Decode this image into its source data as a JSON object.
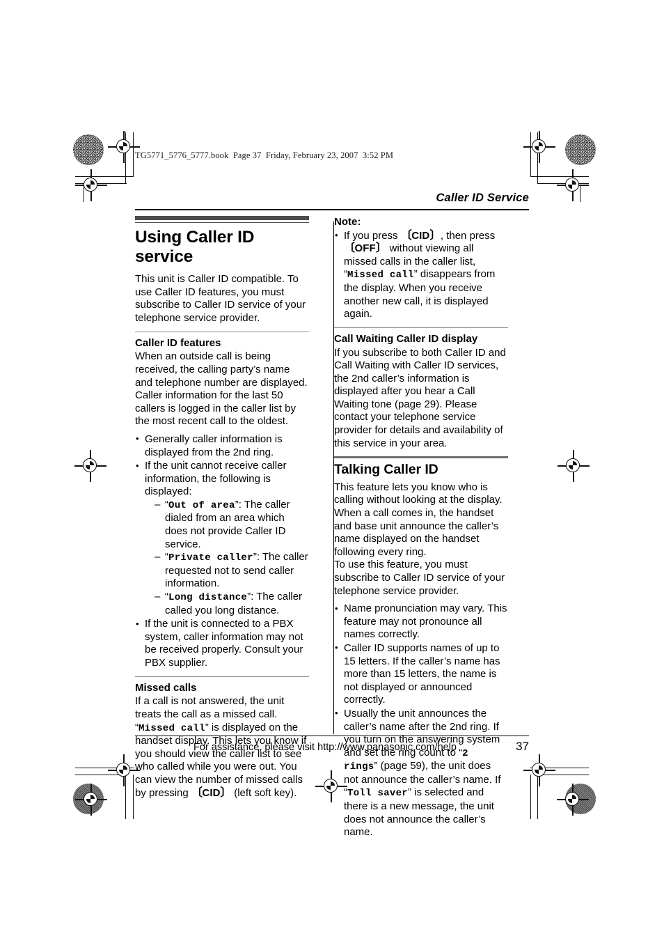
{
  "document": {
    "book_header": "TG5771_5776_5777.book  Page 37  Friday, February 23, 2007  3:52 PM",
    "running_head": "Caller ID Service",
    "footer_note": "For assistance, please visit http://www.panasonic.com/help",
    "page_number": "37"
  },
  "left_column": {
    "title": "Using Caller ID service",
    "intro": "This unit is Caller ID compatible. To use Caller ID features, you must subscribe to Caller ID service of your telephone service provider.",
    "features": {
      "heading": "Caller ID features",
      "para1": "When an outside call is being received, the calling party’s name and telephone number are displayed.",
      "para2": "Caller information for the last 50 callers is logged in the caller list by the most recent call to the oldest.",
      "bullet1": "Generally caller information is displayed from the 2nd ring.",
      "bullet2_lead": "If the unit cannot receive caller information, the following is displayed:",
      "sub_items": [
        {
          "quote_open": "“",
          "term": "Out of area",
          "quote_close": "”",
          "text": ": The caller dialed from an area which does not provide Caller ID service."
        },
        {
          "quote_open": "“",
          "term": "Private caller",
          "quote_close": "”",
          "text": ": The caller requested not to send caller information."
        },
        {
          "quote_open": "“",
          "term": "Long distance",
          "quote_close": "”",
          "text": ": The caller called you long distance."
        }
      ],
      "bullet3": "If the unit is connected to a PBX system, caller information may not be received properly. Consult your PBX supplier."
    },
    "missed_calls": {
      "heading": "Missed calls",
      "text_part1": "If a call is not answered, the unit treats the call as a missed call. “",
      "term1": "Missed call",
      "text_part2": "” is displayed on the handset display. This lets you know if you should view the caller list to see who called while you were out. You can view the number of missed calls by pressing ",
      "key1": "CID",
      "text_part3": " (left soft key)."
    }
  },
  "right_column": {
    "note": {
      "label": "Note:",
      "text_part1": "If you press ",
      "key1": "CID",
      "text_part2": ", then press ",
      "key2": "OFF",
      "text_part3": " without viewing all missed calls in the caller list, “",
      "term1": "Missed call",
      "text_part4": "” disappears from the display. When you receive another new call, it is displayed again."
    },
    "call_waiting": {
      "heading": "Call Waiting Caller ID display",
      "text": "If you subscribe to both Caller ID and Call Waiting with Caller ID services, the 2nd caller’s information is displayed after you hear a Call Waiting tone (page 29). Please contact your telephone service provider for details and availability of this service in your area."
    },
    "talking_caller_id": {
      "heading": "Talking Caller ID",
      "para1": "This feature lets you know who is calling without looking at the display. When a call comes in, the handset and base unit announce the caller’s name displayed on the handset following every ring.",
      "para2": "To use this feature, you must subscribe to Caller ID service of your telephone service provider.",
      "bullet1": "Name pronunciation may vary. This feature may not pronounce all names correctly.",
      "bullet2": "Caller ID supports names of up to 15 letters. If the caller’s name has more than 15 letters, the name is not displayed or announced correctly.",
      "bullet3_part1": "Usually the unit announces the caller’s name after the 2nd ring. If you turn on the answering system and set the ring count to “",
      "bullet3_term1": "2 rings",
      "bullet3_part2": "” (page 59), the unit does not announce the caller’s name. If “",
      "bullet3_term2": "Toll saver",
      "bullet3_part3": "” is selected and there is a new message, the unit does not announce the caller’s name."
    }
  },
  "print_marks": {
    "bracket_open": "〔",
    "bracket_close": "〕"
  }
}
